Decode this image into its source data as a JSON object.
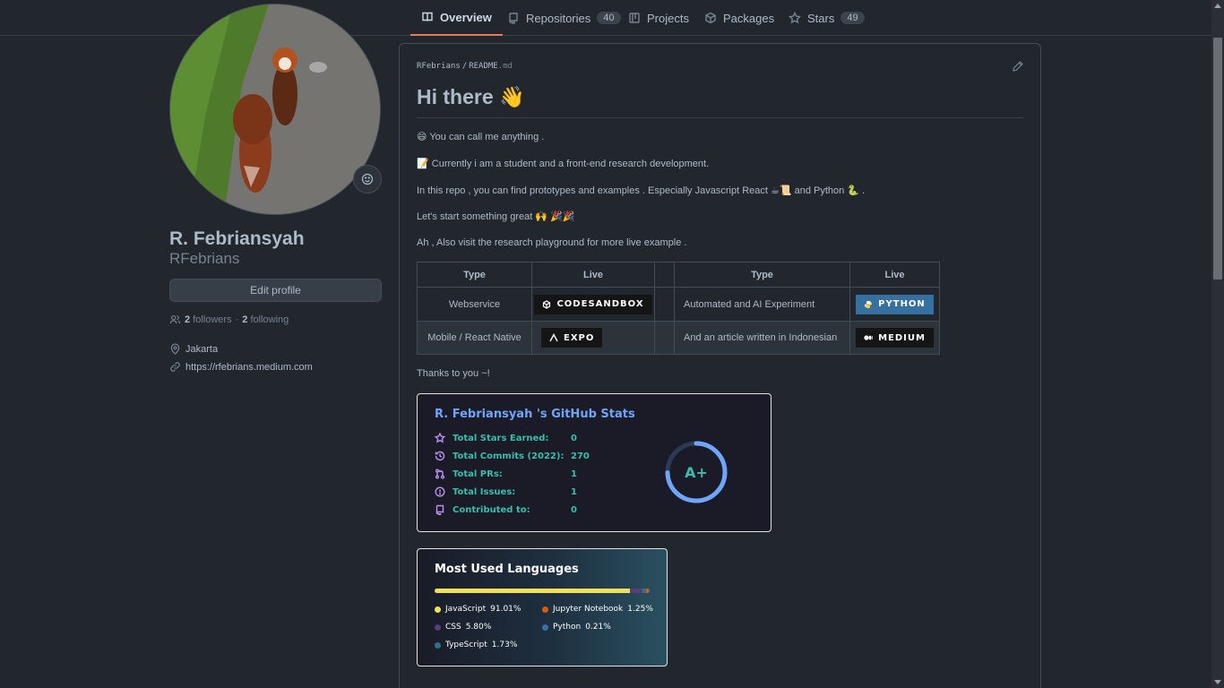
{
  "tabs": [
    {
      "label": "Overview",
      "icon": "book-icon"
    },
    {
      "label": "Repositories",
      "icon": "repo-icon",
      "count": "40"
    },
    {
      "label": "Projects",
      "icon": "project-icon"
    },
    {
      "label": "Packages",
      "icon": "package-icon"
    },
    {
      "label": "Stars",
      "icon": "star-icon",
      "count": "49"
    }
  ],
  "profile": {
    "full_name": "R. Febriansyah",
    "login": "RFebrians",
    "edit_label": "Edit profile",
    "followers_count": "2",
    "followers_label": "followers",
    "separator": "·",
    "following_count": "2",
    "following_label": "following",
    "location": "Jakarta",
    "website": "https://rfebrians.medium.com"
  },
  "readme": {
    "path_user": "RFebrians",
    "path_sep": "/",
    "path_file": "README",
    "path_ext": ".md",
    "heading": "Hi there 👋",
    "lines": [
      "😄 You can call me anything .",
      "📝 Currently i am a student and a front-end research development.",
      "In this repo , you can find prototypes and examples . Especially Javascript React ☕📜 and Python 🐍 .",
      "Let's start something great 🙌 🎉🎉",
      "Ah , Also visit the research playground for more live example ."
    ],
    "table": {
      "headers": [
        "Type",
        "Live",
        "",
        "Type",
        "Live"
      ],
      "rows": [
        {
          "type1": "Webservice",
          "badge1": "CODESANDBOX",
          "type2": "Automated and AI Experiment",
          "badge2": "PYTHON"
        },
        {
          "type1": "Mobile / React Native",
          "badge1": "EXPO",
          "type2": "And an article written in Indonesian",
          "badge2": "MEDIUM"
        }
      ]
    },
    "thanks": "Thanks to you ~!"
  },
  "stats_card": {
    "title": "R. Febriansyah 's GitHub Stats",
    "rows": [
      {
        "label": "Total Stars Earned:",
        "value": "0",
        "icon": "star-icon"
      },
      {
        "label": "Total Commits (2022):",
        "value": "270",
        "icon": "history-icon"
      },
      {
        "label": "Total PRs:",
        "value": "1",
        "icon": "pull-request-icon"
      },
      {
        "label": "Total Issues:",
        "value": "1",
        "icon": "issue-icon"
      },
      {
        "label": "Contributed to:",
        "value": "0",
        "icon": "repo-icon"
      }
    ],
    "grade": "A+",
    "colors": {
      "title": "#70a5fd",
      "text": "#38bdae",
      "icon": "#bf91f3",
      "bg": "#1a1b27"
    }
  },
  "langs_card": {
    "title": "Most Used Languages",
    "languages": [
      {
        "name": "JavaScript",
        "percent": "91.01%",
        "pct": 91.01,
        "color": "#f1e05a"
      },
      {
        "name": "CSS",
        "percent": "5.80%",
        "pct": 5.8,
        "color": "#563d7c"
      },
      {
        "name": "TypeScript",
        "percent": "1.73%",
        "pct": 1.73,
        "color": "#2b7489"
      },
      {
        "name": "Jupyter Notebook",
        "percent": "1.25%",
        "pct": 1.25,
        "color": "#da5b0b"
      },
      {
        "name": "Python",
        "percent": "0.21%",
        "pct": 0.21,
        "color": "#3572a5"
      }
    ]
  },
  "colors": {
    "accent": "#ec775c",
    "bg": "#22272e",
    "border": "#444c56"
  }
}
